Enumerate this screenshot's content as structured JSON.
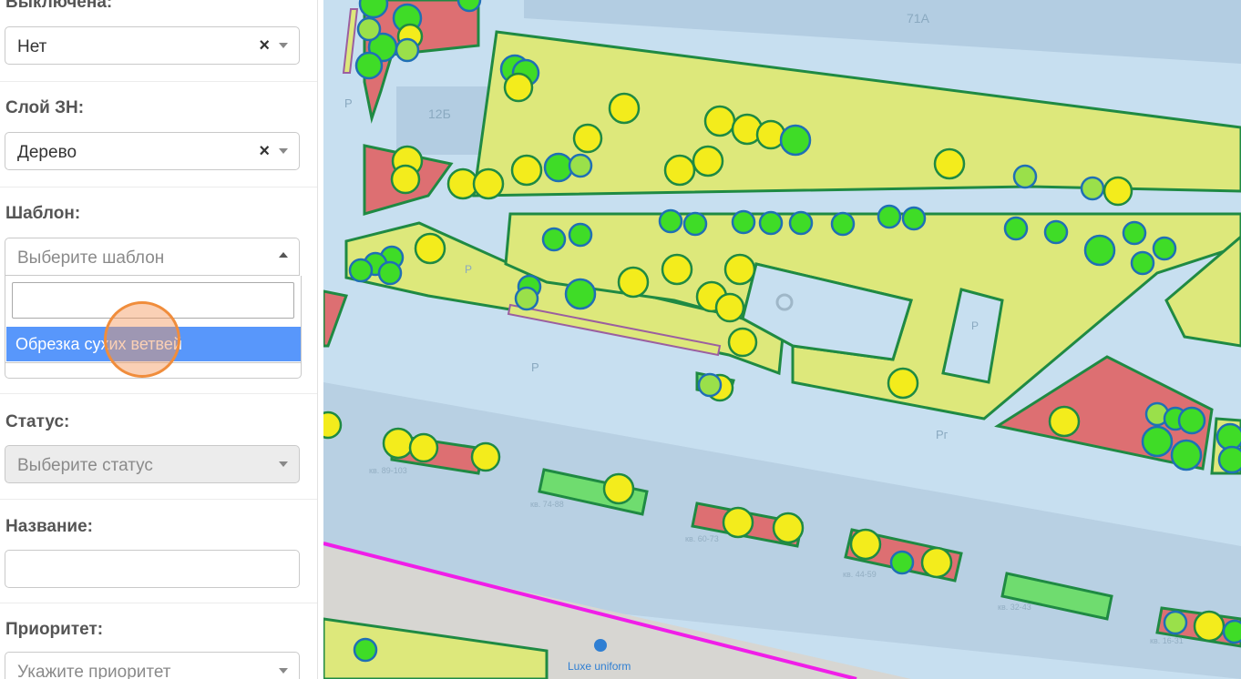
{
  "form": {
    "disabled": {
      "label": "Выключена:",
      "value": "Нет"
    },
    "layer": {
      "label": "Слой ЗН:",
      "value": "Дерево"
    },
    "template": {
      "label": "Шаблон:",
      "placeholder": "Выберите шаблон",
      "search_value": "",
      "options": [
        "Обрезка сухих ветвей"
      ]
    },
    "status": {
      "label": "Статус:",
      "placeholder": "Выберите статус"
    },
    "name": {
      "label": "Название:",
      "value": ""
    },
    "priority": {
      "label": "Приоритет:",
      "placeholder": "Укажите приоритет"
    }
  },
  "map": {
    "building_labels": [
      "71А",
      "12Б",
      "Р",
      "Р",
      "Р",
      "Р",
      "Рг"
    ],
    "address_labels": [
      "кв. 89-103",
      "кв. 74-88",
      "кв. 60-73",
      "кв. 44-59",
      "кв. 32-43",
      "кв. 16-31"
    ],
    "poi_label": "Luxe uniform",
    "colors": {
      "tree_yellow": "#f3ec1c",
      "tree_green": "#3fdc27",
      "tree_lightgreen": "#9ae04a",
      "lawn": "#dde87b",
      "flowerbed": "#dd6f72",
      "road": "#c7dff0",
      "boundary": "#f01ee8"
    }
  }
}
